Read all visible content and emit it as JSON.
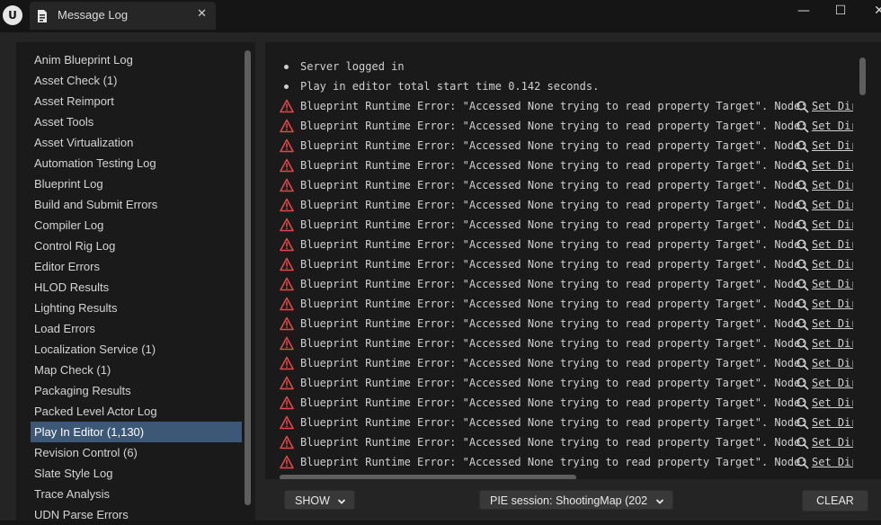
{
  "window": {
    "logo_text": "U",
    "tab_title": "Message Log",
    "tab_close": "✕",
    "minimize": "—",
    "maximize": "☐",
    "close": "✕"
  },
  "categories": [
    {
      "label": "Anim Blueprint Log",
      "selected": false
    },
    {
      "label": "Asset Check (1)",
      "selected": false
    },
    {
      "label": "Asset Reimport",
      "selected": false
    },
    {
      "label": "Asset Tools",
      "selected": false
    },
    {
      "label": "Asset Virtualization",
      "selected": false
    },
    {
      "label": "Automation Testing Log",
      "selected": false
    },
    {
      "label": "Blueprint Log",
      "selected": false
    },
    {
      "label": "Build and Submit Errors",
      "selected": false
    },
    {
      "label": "Compiler Log",
      "selected": false
    },
    {
      "label": "Control Rig Log",
      "selected": false
    },
    {
      "label": "Editor Errors",
      "selected": false
    },
    {
      "label": "HLOD Results",
      "selected": false
    },
    {
      "label": "Lighting Results",
      "selected": false
    },
    {
      "label": "Load Errors",
      "selected": false
    },
    {
      "label": "Localization Service (1)",
      "selected": false
    },
    {
      "label": "Map Check (1)",
      "selected": false
    },
    {
      "label": "Packaging Results",
      "selected": false
    },
    {
      "label": "Packed Level Actor Log",
      "selected": false
    },
    {
      "label": "Play In Editor (1,130)",
      "selected": true
    },
    {
      "label": "Revision Control (6)",
      "selected": false
    },
    {
      "label": "Slate Style Log",
      "selected": false
    },
    {
      "label": "Trace Analysis",
      "selected": false
    },
    {
      "label": "UDN Parse Errors",
      "selected": false
    }
  ],
  "log_lines": [
    {
      "kind": "info",
      "text": "Server logged in"
    },
    {
      "kind": "info",
      "text": "Play in editor total start time 0.142 seconds."
    },
    {
      "kind": "error",
      "text": "Blueprint Runtime Error: \"Accessed None trying to read property Target\". Node:",
      "link": "Set Dir"
    },
    {
      "kind": "error",
      "text": "Blueprint Runtime Error: \"Accessed None trying to read property Target\". Node:",
      "link": "Set Dir"
    },
    {
      "kind": "error",
      "text": "Blueprint Runtime Error: \"Accessed None trying to read property Target\". Node:",
      "link": "Set Dir"
    },
    {
      "kind": "error",
      "text": "Blueprint Runtime Error: \"Accessed None trying to read property Target\". Node:",
      "link": "Set Dir"
    },
    {
      "kind": "error",
      "text": "Blueprint Runtime Error: \"Accessed None trying to read property Target\". Node:",
      "link": "Set Dir"
    },
    {
      "kind": "error",
      "text": "Blueprint Runtime Error: \"Accessed None trying to read property Target\". Node:",
      "link": "Set Dir"
    },
    {
      "kind": "error",
      "text": "Blueprint Runtime Error: \"Accessed None trying to read property Target\". Node:",
      "link": "Set Dir"
    },
    {
      "kind": "error",
      "text": "Blueprint Runtime Error: \"Accessed None trying to read property Target\". Node:",
      "link": "Set Dir"
    },
    {
      "kind": "error",
      "text": "Blueprint Runtime Error: \"Accessed None trying to read property Target\". Node:",
      "link": "Set Dir"
    },
    {
      "kind": "error",
      "text": "Blueprint Runtime Error: \"Accessed None trying to read property Target\". Node:",
      "link": "Set Dir"
    },
    {
      "kind": "error",
      "text": "Blueprint Runtime Error: \"Accessed None trying to read property Target\". Node:",
      "link": "Set Dir"
    },
    {
      "kind": "error",
      "text": "Blueprint Runtime Error: \"Accessed None trying to read property Target\". Node:",
      "link": "Set Dir"
    },
    {
      "kind": "error",
      "text": "Blueprint Runtime Error: \"Accessed None trying to read property Target\". Node:",
      "link": "Set Dir"
    },
    {
      "kind": "error",
      "text": "Blueprint Runtime Error: \"Accessed None trying to read property Target\". Node:",
      "link": "Set Dir"
    },
    {
      "kind": "error",
      "text": "Blueprint Runtime Error: \"Accessed None trying to read property Target\". Node:",
      "link": "Set Dir"
    },
    {
      "kind": "error",
      "text": "Blueprint Runtime Error: \"Accessed None trying to read property Target\". Node:",
      "link": "Set Dir"
    },
    {
      "kind": "error",
      "text": "Blueprint Runtime Error: \"Accessed None trying to read property Target\". Node:",
      "link": "Set Dir"
    },
    {
      "kind": "error",
      "text": "Blueprint Runtime Error: \"Accessed None trying to read property Target\". Node:",
      "link": "Set Dir"
    },
    {
      "kind": "error",
      "text": "Blueprint Runtime Error: \"Accessed None trying to read property Target\". Node:",
      "link": "Set Dir"
    },
    {
      "kind": "error",
      "text": "Blueprint Runtime Error: \"Accessed None trying to read property Target\". Node:",
      "link": "Set Dir"
    }
  ],
  "toolbar": {
    "show_label": "SHOW",
    "session_label": "PIE session: ShootingMap (202",
    "clear_label": "CLEAR"
  },
  "colors": {
    "error": "#e04848",
    "selected": "#3d5877"
  }
}
